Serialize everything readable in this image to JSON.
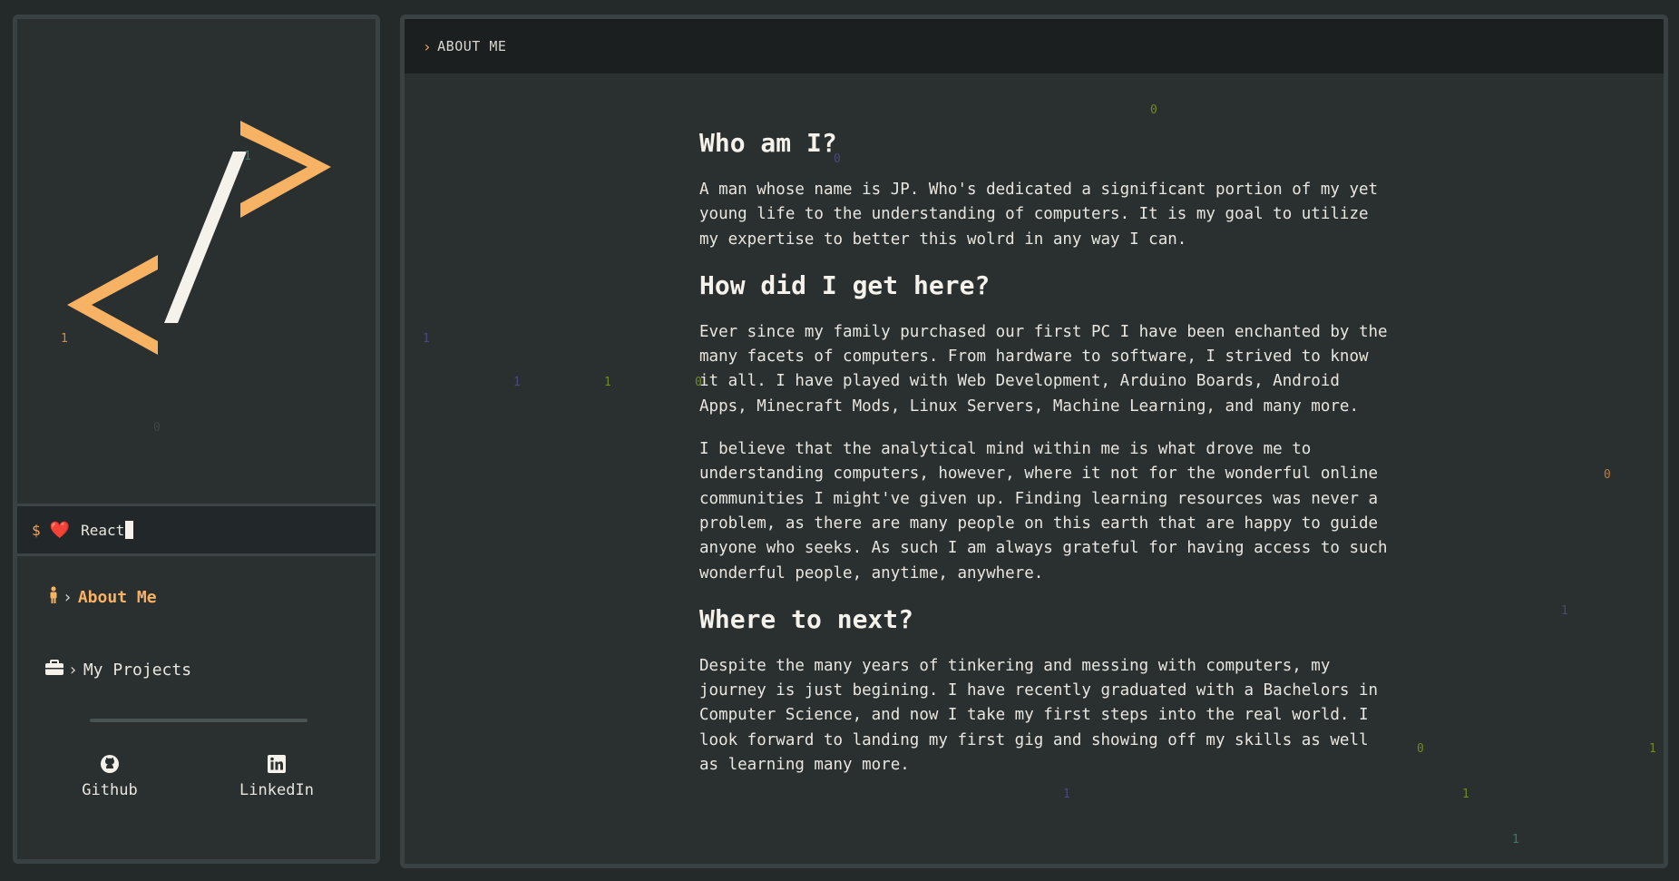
{
  "sidebar": {
    "terminal": {
      "prompt": "$",
      "heart": "❤️",
      "text": "React"
    },
    "nav": [
      {
        "label": "About Me",
        "icon": "person-icon",
        "active": true
      },
      {
        "label": "My Projects",
        "icon": "briefcase-icon",
        "active": false
      }
    ],
    "social": [
      {
        "label": "Github",
        "icon": "github-icon"
      },
      {
        "label": "LinkedIn",
        "icon": "linkedin-icon"
      }
    ]
  },
  "main": {
    "breadcrumb": "ABOUT ME",
    "sections": [
      {
        "heading": "Who am I?",
        "paragraphs": [
          "A man whose name is JP. Who's dedicated a significant portion of my yet young life to the understanding of computers. It is my goal to utilize my expertise to better this wolrd in any way I can."
        ]
      },
      {
        "heading": "How did I get here?",
        "paragraphs": [
          "Ever since my family purchased our first PC I have been enchanted by the many facets of computers. From hardware to software, I strived to know it all. I have played with Web Development, Arduino Boards, Android Apps, Minecraft Mods, Linux Servers, Machine Learning, and many more.",
          "I believe that the analytical mind within me is what drove me to understanding computers, however, where it not for the wonderful online communities I might've given up. Finding learning resources was never a problem, as there are many people on this earth that are happy to guide anyone who seeks. As such I am always grateful for having access to such wonderful people, anytime, anywhere."
        ]
      },
      {
        "heading": "Where to next?",
        "paragraphs": [
          "Despite the many years of tinkering and messing with computers, my journey is just begining. I have recently graduated with a Bachelors in Computer Science, and now I take my first steps into the real world. I look forward to landing my first gig and showing off my skills as well as learning many more."
        ]
      }
    ]
  },
  "colors": {
    "accent": "#f7b264",
    "background": "#2a2f30",
    "header": "#1b1f20",
    "heart": "#e0313d"
  }
}
